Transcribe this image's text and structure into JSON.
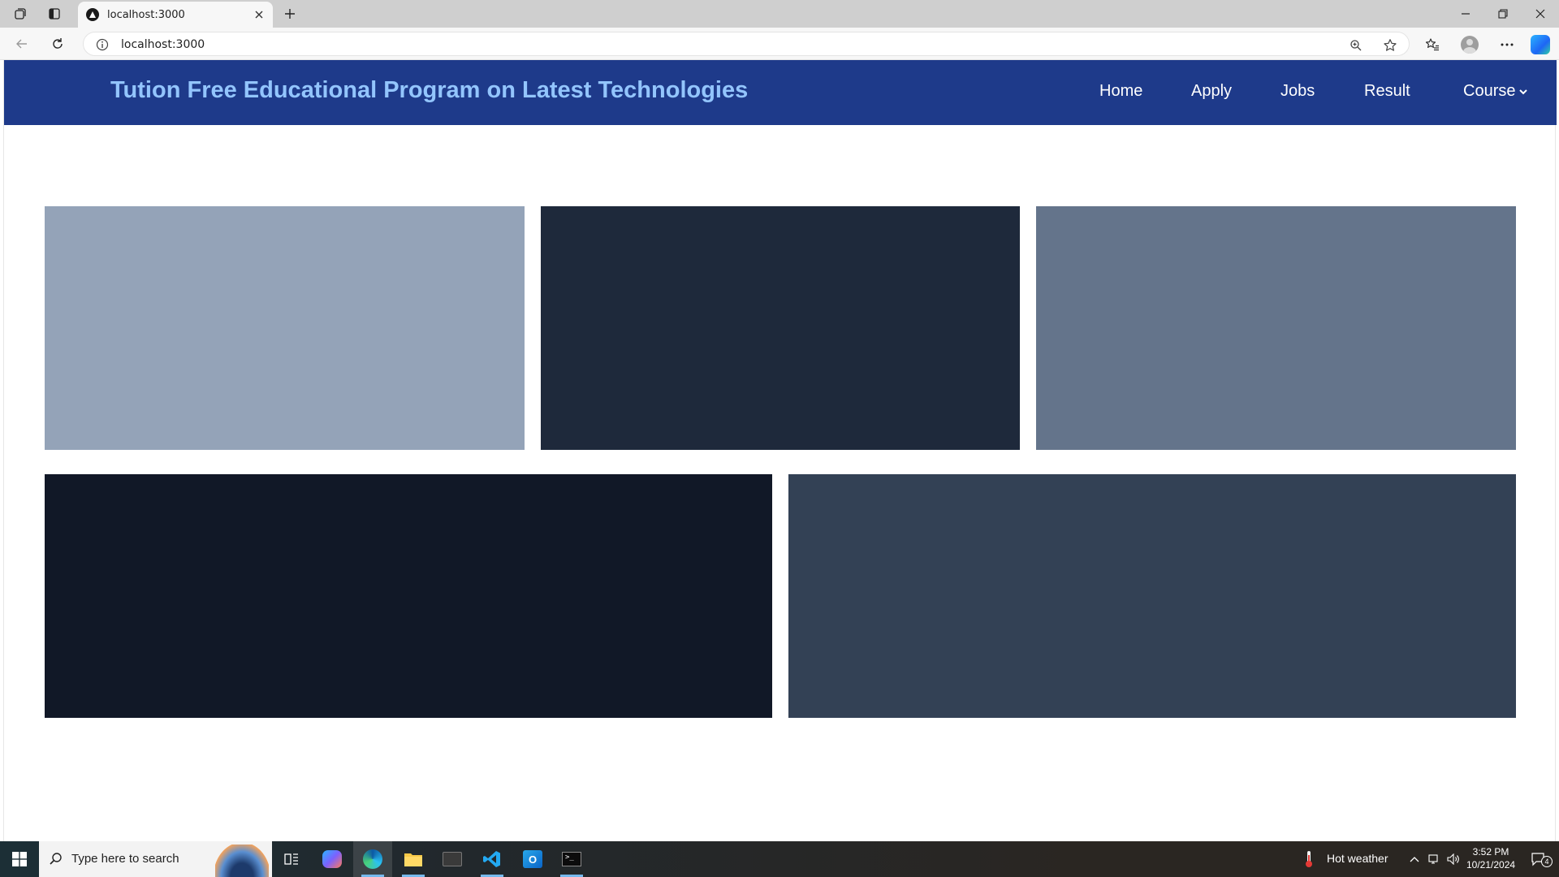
{
  "browser": {
    "tab_title": "localhost:3000",
    "url": "localhost:3000"
  },
  "site": {
    "title": "Tution Free Educational Program on Latest Technologies",
    "nav": {
      "home": "Home",
      "apply": "Apply",
      "jobs": "Jobs",
      "result": "Result",
      "course": "Course"
    },
    "colors": {
      "nav_bg": "#1e3a8a",
      "title": "#93c5fd",
      "card_1": "#94a3b8",
      "card_2": "#1e293b",
      "card_3": "#64748b",
      "card_4": "#111827",
      "card_5": "#334155"
    }
  },
  "taskbar": {
    "search_placeholder": "Type here to search",
    "weather": "Hot weather",
    "time": "3:52 PM",
    "date": "10/21/2024",
    "notification_count": "4"
  }
}
